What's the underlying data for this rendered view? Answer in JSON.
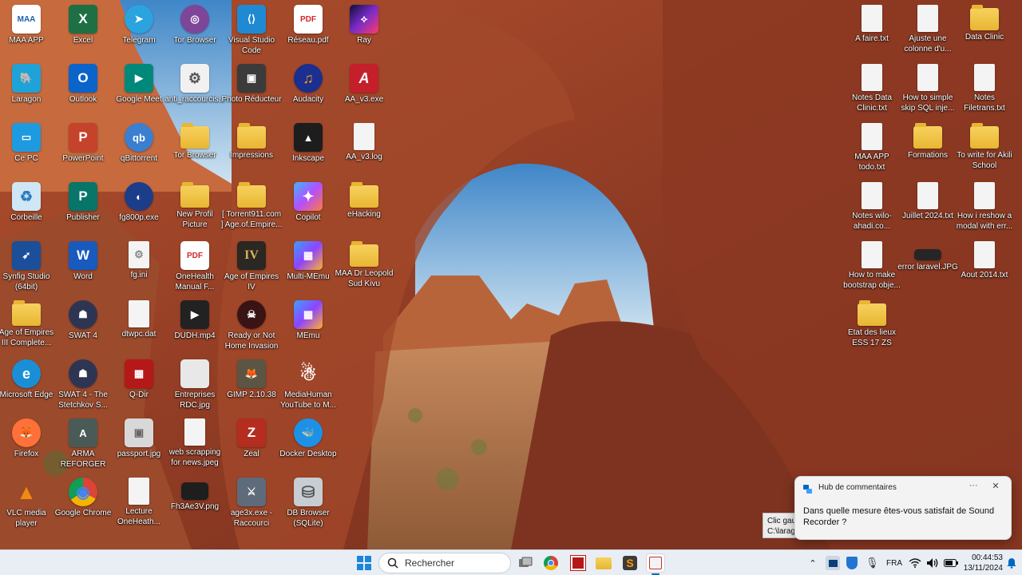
{
  "desktop_icons": {
    "maa_app": {
      "label": "MAA APP",
      "glyph": "MAA"
    },
    "excel": {
      "label": "Excel",
      "glyph": "X"
    },
    "telegram": {
      "label": "Telegram",
      "glyph": "➤"
    },
    "tor_browser_1": {
      "label": "Tor Browser",
      "glyph": "◎"
    },
    "vscode": {
      "label": "Visual Studio Code",
      "glyph": "⟨⟩"
    },
    "reseau_pdf": {
      "label": "Réseau.pdf",
      "glyph": "PDF"
    },
    "ray": {
      "label": "Ray",
      "glyph": "⟡"
    },
    "laragon": {
      "label": "Laragon",
      "glyph": "🐘"
    },
    "outlook": {
      "label": "Outlook",
      "glyph": "O"
    },
    "google_meet": {
      "label": "Google Meet",
      "glyph": "▶"
    },
    "anti_raccourcis": {
      "label": "anti_raccourcis...",
      "glyph": "⚙"
    },
    "photo_reducteur": {
      "label": "Photo Réducteur",
      "glyph": "▣"
    },
    "audacity": {
      "label": "Audacity",
      "glyph": "♫"
    },
    "aa_v3_exe": {
      "label": "AA_v3.exe",
      "glyph": "A"
    },
    "ce_pc": {
      "label": "Ce PC",
      "glyph": "▭"
    },
    "powerpoint": {
      "label": "PowerPoint",
      "glyph": "P"
    },
    "qbittorrent": {
      "label": "qBittorrent",
      "glyph": "qb"
    },
    "tor_browser_2": {
      "label": "Tor Browser",
      "glyph": ""
    },
    "impressions": {
      "label": "Impressions",
      "glyph": ""
    },
    "inkscape": {
      "label": "Inkscape",
      "glyph": "▲"
    },
    "aa_v3_log": {
      "label": "AA_v3.log",
      "glyph": ""
    },
    "corbeille": {
      "label": "Corbeille",
      "glyph": "♻"
    },
    "publisher": {
      "label": "Publisher",
      "glyph": "P"
    },
    "fg800p": {
      "label": "fg800p.exe",
      "glyph": "◐"
    },
    "new_profil": {
      "label": "New Profil Picture",
      "glyph": ""
    },
    "torrent911": {
      "label": "[ Torrent911.com ] Age.of.Empire...",
      "glyph": ""
    },
    "copilot": {
      "label": "Copilot",
      "glyph": "✦"
    },
    "ehacking": {
      "label": "eHacking",
      "glyph": ""
    },
    "synfig": {
      "label": "Synfig Studio (64bit)",
      "glyph": "➶"
    },
    "word": {
      "label": "Word",
      "glyph": "W"
    },
    "fg_ini": {
      "label": "fg.ini",
      "glyph": "⚙"
    },
    "onehealth_manual": {
      "label": "OneHealth Manual F...",
      "glyph": "PDF"
    },
    "aoe4": {
      "label": "Age of Empires IV",
      "glyph": "IV"
    },
    "multi_memu": {
      "label": "Multi-MEmu",
      "glyph": "▦"
    },
    "maa_dr_leopold": {
      "label": "MAA Dr Leopold Sud Kivu",
      "glyph": ""
    },
    "aoe3": {
      "label": "Age of Empires III Complete...",
      "glyph": ""
    },
    "swat4": {
      "label": "SWAT 4",
      "glyph": "☗"
    },
    "dtwpc": {
      "label": "dtwpc.dat",
      "glyph": ""
    },
    "dudh": {
      "label": "DUDH.mp4",
      "glyph": "▶"
    },
    "ready_or_not": {
      "label": "Ready or Not Home Invasion",
      "glyph": "☠"
    },
    "memu": {
      "label": "MEmu",
      "glyph": "▦"
    },
    "edge": {
      "label": "Microsoft Edge",
      "glyph": "e"
    },
    "swat4_stetchkov": {
      "label": "SWAT 4 - The Stetchkov S...",
      "glyph": "☗"
    },
    "q_dir": {
      "label": "Q-Dir",
      "glyph": "▦"
    },
    "entreprises_rdc": {
      "label": "Entreprises RDC.jpg",
      "glyph": ""
    },
    "gimp": {
      "label": "GIMP 2.10.38",
      "glyph": "🦊"
    },
    "mediahuman": {
      "label": "MediaHuman YouTube to M...",
      "glyph": "☃"
    },
    "firefox": {
      "label": "Firefox",
      "glyph": "🦊"
    },
    "arma": {
      "label": "ARMA REFORGER",
      "glyph": "A"
    },
    "passport": {
      "label": "passport.jpg",
      "glyph": "▣"
    },
    "web_scrapping": {
      "label": "web scrapping for news.jpeg",
      "glyph": ""
    },
    "zeal": {
      "label": "Zeal",
      "glyph": "Z"
    },
    "docker": {
      "label": "Docker Desktop",
      "glyph": "🐳"
    },
    "vlc": {
      "label": "VLC media player",
      "glyph": "▲"
    },
    "chrome": {
      "label": "Google Chrome",
      "glyph": "◉"
    },
    "lecture_onehealth": {
      "label": "Lecture OneHeath...",
      "glyph": ""
    },
    "fh3ae3v": {
      "label": "Fh3Ae3V.png",
      "glyph": ""
    },
    "age3x": {
      "label": "age3x.exe - Raccourci",
      "glyph": "⚔"
    },
    "db_browser": {
      "label": "DB Browser (SQLite)",
      "glyph": "⛁"
    },
    "a_faire": {
      "label": "A faire.txt",
      "glyph": ""
    },
    "ajuste_une": {
      "label": "Ajuste une colonne d'u...",
      "glyph": ""
    },
    "data_clinic": {
      "label": "Data Clinic",
      "glyph": ""
    },
    "notes_data_clinic": {
      "label": "Notes Data Clinic.txt",
      "glyph": ""
    },
    "how_to_simple": {
      "label": "How to simple skip SQL inje...",
      "glyph": ""
    },
    "notes_filetrans": {
      "label": "Notes Filetrans.txt",
      "glyph": ""
    },
    "maa_app_todo": {
      "label": "MAA APP todo.txt",
      "glyph": ""
    },
    "formations": {
      "label": "Formations",
      "glyph": ""
    },
    "to_write_akili": {
      "label": "To write for Akili School",
      "glyph": ""
    },
    "notes_wilo": {
      "label": "Notes wilo-ahadi.co...",
      "glyph": ""
    },
    "juillet_2024": {
      "label": "Juillet 2024.txt",
      "glyph": ""
    },
    "how_i_reshow": {
      "label": "How i reshow a modal with err...",
      "glyph": ""
    },
    "how_to_make_bootstrap": {
      "label": "How to make bootstrap obje...",
      "glyph": ""
    },
    "error_laravel": {
      "label": "error laravel.JPG",
      "glyph": ""
    },
    "aout_2014": {
      "label": "Aout 2014.txt",
      "glyph": ""
    },
    "etat_des_lieux": {
      "label": "Etat des lieux ESS 17 ZS",
      "glyph": ""
    }
  },
  "notification": {
    "app_name": "Hub de commentaires",
    "more": "···",
    "close": "✕",
    "message": "Dans quelle mesure êtes-vous satisfait de Sound Recorder ?"
  },
  "tooltip": {
    "line1": "Clic gauc",
    "line2": "C:\\larago"
  },
  "taskbar": {
    "search_placeholder": "Rechercher",
    "language": "FRA",
    "time": "00:44:53",
    "date": "13/11/2024",
    "chevron": "⌃"
  },
  "colors": {
    "taskbar_bg": "#e9eef5",
    "accent": "#0067c0"
  }
}
